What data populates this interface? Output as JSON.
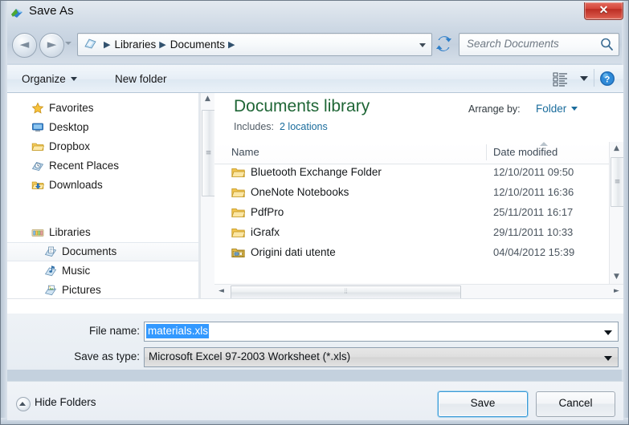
{
  "window": {
    "title": "Save As",
    "title_icon": "save-as-icon",
    "close_label": "✕"
  },
  "navbar": {
    "back_icon": "back-arrow-icon",
    "back_glyph": "◄",
    "forward_icon": "forward-arrow-icon",
    "forward_glyph": "►",
    "history_icon": "chevron-down-icon",
    "address_icon": "library-folder-icon",
    "breadcrumbs": [
      "Libraries",
      "Documents"
    ],
    "separator": "▶",
    "address_caret_icon": "chevron-down-icon",
    "refresh_icon": "refresh-icon",
    "search": {
      "placeholder": "Search Documents",
      "icon": "search-icon"
    }
  },
  "commandbar": {
    "organize": "Organize",
    "new_folder": "New folder",
    "view_mode_icon": "view-mode-list-icon",
    "view_mode_caret_icon": "chevron-down-icon",
    "help_icon": "help-icon",
    "help_glyph": "?"
  },
  "nav_pane": {
    "groups": [
      {
        "header": {
          "label": "Favorites",
          "icon": "star-icon",
          "level": 0
        },
        "items": [
          {
            "label": "Desktop",
            "icon": "desktop-icon",
            "level": 0
          },
          {
            "label": "Dropbox",
            "icon": "folder-icon",
            "level": 0
          },
          {
            "label": "Recent Places",
            "icon": "recent-places-icon",
            "level": 0
          },
          {
            "label": "Downloads",
            "icon": "downloads-folder-icon",
            "level": 0
          }
        ]
      },
      {
        "header": {
          "label": "Libraries",
          "icon": "libraries-icon",
          "level": 0
        },
        "items": [
          {
            "label": "Documents",
            "icon": "documents-library-icon",
            "level": 1,
            "selected": true
          },
          {
            "label": "Music",
            "icon": "music-library-icon",
            "level": 1
          },
          {
            "label": "Pictures",
            "icon": "pictures-library-icon",
            "level": 1
          }
        ]
      }
    ],
    "scrollbar": {
      "up_glyph": "▲",
      "down_glyph": "▼",
      "grip": "≡"
    }
  },
  "list_pane": {
    "library_title": "Documents library",
    "includes_label": "Includes:",
    "includes_value": "2 locations",
    "arrange_label": "Arrange by:",
    "arrange_value": "Folder",
    "arrange_caret": "▾",
    "columns": [
      "Name",
      "Date modified"
    ],
    "sort_column": "Date modified",
    "sort_direction": "ascending",
    "rows": [
      {
        "name": "Bluetooth Exchange Folder",
        "date": "12/10/2011 09:50",
        "icon": "folder-icon"
      },
      {
        "name": "OneNote Notebooks",
        "date": "12/10/2011 16:36",
        "icon": "folder-icon"
      },
      {
        "name": "PdfPro",
        "date": "25/11/2011 16:17",
        "icon": "folder-icon"
      },
      {
        "name": "iGrafx",
        "date": "29/11/2011 10:33",
        "icon": "folder-icon"
      },
      {
        "name": "Origini dati utente",
        "date": "04/04/2012 15:39",
        "icon": "special-folder-icon"
      }
    ],
    "scrollbar": {
      "up_glyph": "▲",
      "down_glyph": "▼",
      "grip": "≡"
    },
    "hscrollbar": {
      "left_glyph": "◄",
      "right_glyph": "►",
      "grip": "⦙⦙"
    }
  },
  "form": {
    "filename_label": "File name:",
    "filename_value": "materials.xls",
    "filename_caret_icon": "chevron-down-icon",
    "filetype_label": "Save as type:",
    "filetype_value": "Microsoft Excel 97-2003 Worksheet (*.xls)",
    "filetype_caret_icon": "chevron-down-icon"
  },
  "footer": {
    "hide_folders_label": "Hide Folders",
    "hide_folders_icon": "chevron-up-circle-icon",
    "save_label": "Save",
    "cancel_label": "Cancel"
  },
  "colors": {
    "accent_blue": "#3399ff",
    "library_green": "#1f6636",
    "link_blue": "#1a6c9c",
    "close_red": "#d4453a",
    "default_button_border": "#3c9ad6"
  }
}
